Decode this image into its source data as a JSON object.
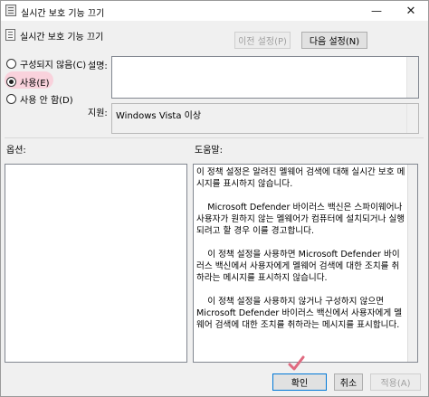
{
  "window": {
    "title": "실시간 보호 기능 끄기",
    "minimize_glyph": "—",
    "close_glyph": "✕"
  },
  "header": {
    "setting_title": "실시간 보호 기능 끄기",
    "prev_label": "이전 설정(P)",
    "next_label": "다음 설정(N)"
  },
  "options": {
    "radios": [
      {
        "label": "구성되지 않음(C)",
        "checked": false
      },
      {
        "label": "사용(E)",
        "checked": true
      },
      {
        "label": "사용 안 함(D)",
        "checked": false
      }
    ]
  },
  "labels": {
    "comment": "설명:",
    "supported": "지원:",
    "options": "옵션:",
    "help": "도움말:"
  },
  "supported_on": "Windows Vista 이상",
  "help_paragraphs": [
    "이 정책 설정은 알려진 멜웨어 검색에 대해 실시간 보호 메시지를 표시하지 않습니다.",
    "    Microsoft Defender 바이러스 백신은 스파이웨어나 사용자가 원하지 않는 멜웨어가 컴퓨터에 설치되거나 실행되려고 할 경우 이를 경고합니다.",
    "    이 정책 설정을 사용하면 Microsoft Defender 바이러스 백신에서 사용자에게 멜웨어 검색에 대한 조치를 취하라는 메시지를 표시하지 않습니다.",
    "    이 정책 설정을 사용하지 않거나 구성하지 않으면 Microsoft Defender 바이러스 백신에서 사용자에게 멜웨어 검색에 대한 조치를 취하라는 메시지를 표시합니다."
  ],
  "footer": {
    "ok_label": "확인",
    "cancel_label": "취소",
    "apply_label": "적용(A)"
  },
  "colors": {
    "highlight": "#f9d2dc",
    "check_mark": "#e06a80"
  }
}
